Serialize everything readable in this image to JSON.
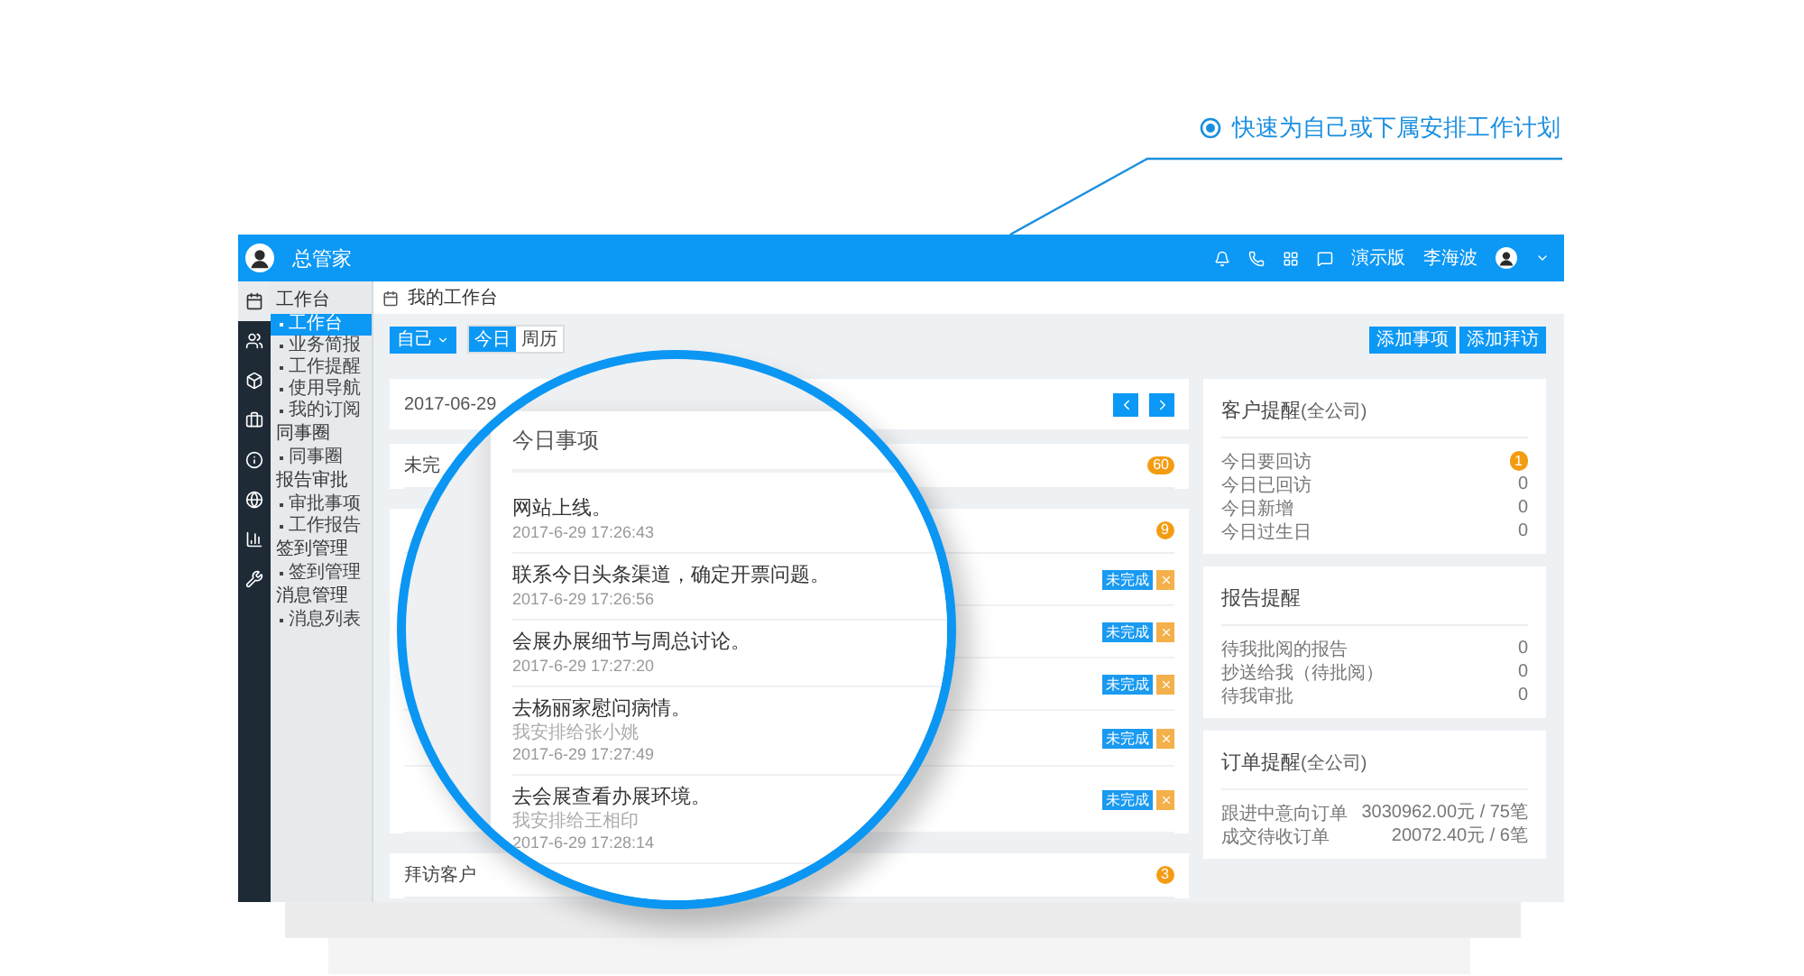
{
  "callout": {
    "text": "快速为自己或下属安排工作计划"
  },
  "topbar": {
    "logo": "总管家",
    "actions": [
      {
        "kind": "bell"
      },
      {
        "kind": "phone"
      },
      {
        "kind": "grid"
      },
      {
        "kind": "message"
      }
    ],
    "plan": "演示版",
    "user": "李海波"
  },
  "icon_rail": [
    {
      "selected": true
    },
    {
      "selected": false
    },
    {
      "selected": false
    },
    {
      "selected": false
    },
    {
      "selected": false
    },
    {
      "selected": false
    },
    {
      "selected": false
    },
    {
      "selected": false
    }
  ],
  "menu": [
    {
      "label": "工作台",
      "children": [
        {
          "label": "工作台",
          "selected": true
        },
        {
          "label": "业务简报",
          "selected": false
        },
        {
          "label": "工作提醒",
          "selected": false
        },
        {
          "label": "使用导航",
          "selected": false
        },
        {
          "label": "我的订阅",
          "selected": false
        }
      ]
    },
    {
      "label": "同事圈",
      "children": [
        {
          "label": "同事圈",
          "selected": false
        }
      ]
    },
    {
      "label": "报告审批",
      "children": [
        {
          "label": "审批事项",
          "selected": false
        },
        {
          "label": "工作报告",
          "selected": false
        }
      ]
    },
    {
      "label": "签到管理",
      "children": [
        {
          "label": "签到管理",
          "selected": false
        }
      ]
    },
    {
      "label": "消息管理",
      "children": [
        {
          "label": "消息列表",
          "selected": false
        }
      ]
    }
  ],
  "breadcrumb": "我的工作台",
  "scope_button": "自己",
  "view_tabs": [
    {
      "label": "今日",
      "selected": true
    },
    {
      "label": "周历",
      "selected": false
    }
  ],
  "actions": [
    "添加事项",
    "添加拜访"
  ],
  "date_bar": {
    "date": "2017-06-29"
  },
  "sections": [
    {
      "title": "未完",
      "badge": "60"
    },
    {
      "badge": "9",
      "rows": [
        {
          "status": "未完成"
        },
        {
          "status": "未完成"
        },
        {
          "status": "未完成"
        },
        {
          "status": "未完成"
        },
        {
          "status": "未完成"
        }
      ]
    },
    {
      "title": "拜访客户",
      "badge": "3"
    }
  ],
  "today": {
    "title": "今日事项",
    "items": [
      {
        "title": "网站上线。",
        "time": "2017-6-29 17:26:43"
      },
      {
        "title": "联系今日头条渠道，确定开票问题。",
        "time": "2017-6-29 17:26:56"
      },
      {
        "title": "会展办展细节与周总讨论。",
        "time": "2017-6-29 17:27:20"
      },
      {
        "title": "去杨丽家慰问病情。",
        "assignee": "我安排给张小姚",
        "time": "2017-6-29 17:27:49"
      },
      {
        "title": "去会展查看办展环境。",
        "assignee": "我安排给王相印",
        "time": "2017-6-29 17:28:14"
      }
    ]
  },
  "side_panels": [
    {
      "title": "客户提醒",
      "scope": "(全公司)",
      "rows": [
        {
          "label": "今日要回访",
          "value": "1",
          "highlight": true
        },
        {
          "label": "今日已回访",
          "value": "0",
          "highlight": false
        },
        {
          "label": "今日新增",
          "value": "0",
          "highlight": false
        },
        {
          "label": "今日过生日",
          "value": "0",
          "highlight": false
        }
      ]
    },
    {
      "title": "报告提醒",
      "rows": [
        {
          "label": "待我批阅的报告",
          "value": "0",
          "highlight": false
        },
        {
          "label": "抄送给我（待批阅）",
          "value": "0",
          "highlight": false
        },
        {
          "label": "待我审批",
          "value": "0",
          "highlight": false
        }
      ]
    },
    {
      "title": "订单提醒",
      "scope": "(全公司)",
      "rows": [
        {
          "label": "跟进中意向订单",
          "value": "3030962.00元 / 75笔",
          "highlight": false
        },
        {
          "label": "成交待收订单",
          "value": "20072.40元 / 6笔",
          "highlight": false
        }
      ]
    }
  ]
}
